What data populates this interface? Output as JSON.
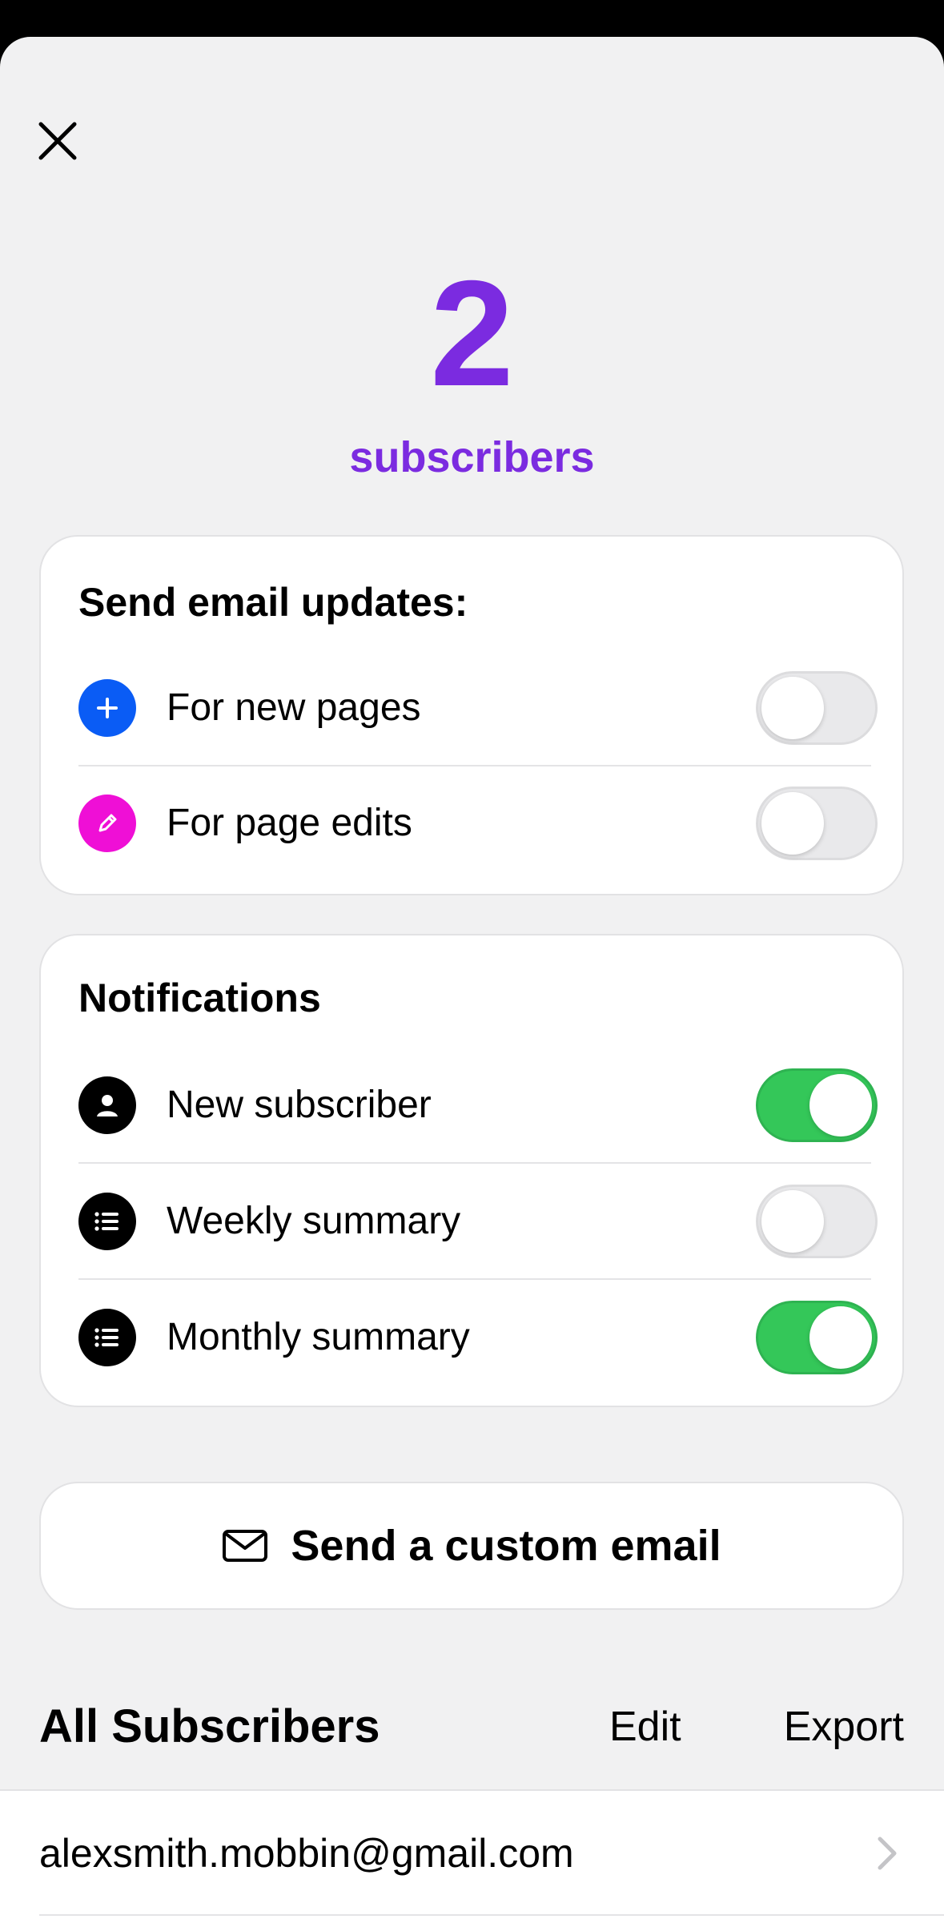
{
  "header": {
    "close_icon": "close-icon"
  },
  "summary": {
    "count": "2",
    "label": "subscribers",
    "accent_color": "#7b2be0"
  },
  "email_updates": {
    "title": "Send email updates:",
    "items": [
      {
        "label": "For new pages",
        "icon": "plus-icon",
        "icon_color": "#0a5cf5",
        "enabled": false
      },
      {
        "label": "For page edits",
        "icon": "pencil-icon",
        "icon_color": "#ef0fd6",
        "enabled": false
      }
    ]
  },
  "notifications": {
    "title": "Notifications",
    "items": [
      {
        "label": "New subscriber",
        "icon": "person-icon",
        "enabled": true
      },
      {
        "label": "Weekly summary",
        "icon": "list-icon",
        "enabled": false
      },
      {
        "label": "Monthly summary",
        "icon": "list-icon",
        "enabled": true
      }
    ]
  },
  "custom_email": {
    "label": "Send a custom email",
    "icon": "envelope-icon"
  },
  "subscribers": {
    "title": "All Subscribers",
    "edit_label": "Edit",
    "export_label": "Export",
    "rows": [
      {
        "email": "alexsmith.mobbin@gmail.com"
      }
    ]
  },
  "colors": {
    "toggle_on": "#34c759",
    "toggle_off": "#e9e9eb",
    "background": "#f1f1f2"
  }
}
